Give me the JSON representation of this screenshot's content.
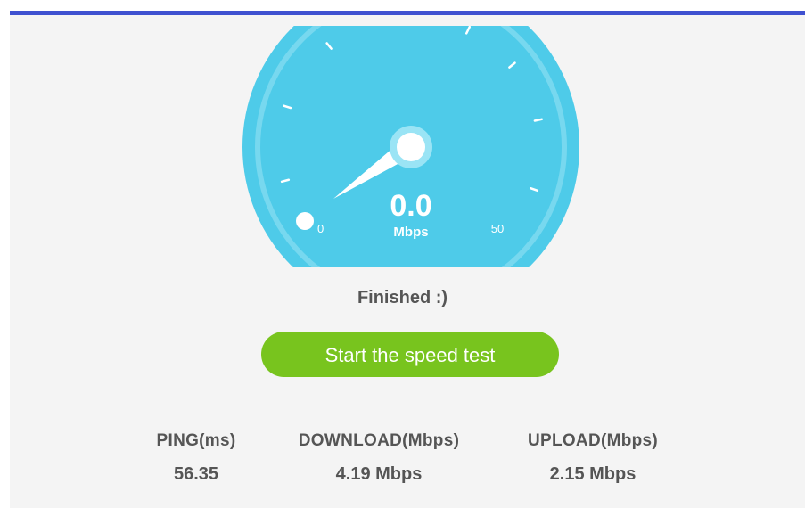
{
  "accent_color": "#3f51d0",
  "gauge": {
    "value": "0.0",
    "unit": "Mbps",
    "min_label": "0",
    "max_label": "50",
    "color": "#4ecbe9"
  },
  "status_text": "Finished :)",
  "start_button": {
    "label": "Start the speed test",
    "color": "#78c41e"
  },
  "stats": [
    {
      "label": "PING(ms)",
      "value": "56.35"
    },
    {
      "label": "DOWNLOAD(Mbps)",
      "value": "4.19 Mbps"
    },
    {
      "label": "UPLOAD(Mbps)",
      "value": "2.15 Mbps"
    }
  ]
}
